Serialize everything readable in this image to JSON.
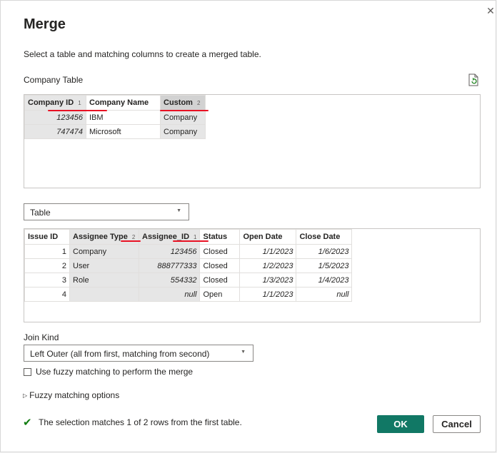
{
  "dialog": {
    "title": "Merge",
    "subtitle": "Select a table and matching columns to create a merged table.",
    "close_icon": "close-icon"
  },
  "first_table": {
    "label": "Company Table",
    "refresh_icon": "refresh-preview-icon",
    "columns": [
      {
        "name": "Company ID",
        "order": "1",
        "selected": true
      },
      {
        "name": "Company Name",
        "order": "",
        "selected": false
      },
      {
        "name": "Custom",
        "order": "2",
        "selected": true
      }
    ],
    "rows": [
      [
        "123456",
        "IBM",
        "Company"
      ],
      [
        "747474",
        "Microsoft",
        "Company"
      ]
    ]
  },
  "second_table": {
    "dropdown_value": "Table",
    "columns": [
      {
        "name": "Issue ID",
        "order": "",
        "selected": false
      },
      {
        "name": "Assignee Type",
        "order": "2",
        "selected": true
      },
      {
        "name": "Assignee_ID",
        "order": "1",
        "selected": true
      },
      {
        "name": "Status",
        "order": "",
        "selected": false
      },
      {
        "name": "Open Date",
        "order": "",
        "selected": false
      },
      {
        "name": "Close Date",
        "order": "",
        "selected": false
      }
    ],
    "rows": [
      [
        "1",
        "Company",
        "123456",
        "Closed",
        "1/1/2023",
        "1/6/2023"
      ],
      [
        "2",
        "User",
        "888777333",
        "Closed",
        "1/2/2023",
        "1/5/2023"
      ],
      [
        "3",
        "Role",
        "554332",
        "Closed",
        "1/3/2023",
        "1/4/2023"
      ],
      [
        "4",
        "",
        "null",
        "Open",
        "1/1/2023",
        "null"
      ]
    ]
  },
  "join": {
    "label": "Join Kind",
    "value": "Left Outer (all from first, matching from second)"
  },
  "fuzzy": {
    "checkbox_label": "Use fuzzy matching to perform the merge",
    "checked": false,
    "options_label": "Fuzzy matching options"
  },
  "status": {
    "icon": "checkmark-icon",
    "text": "The selection matches 1 of 2 rows from the first table."
  },
  "buttons": {
    "ok": "OK",
    "cancel": "Cancel"
  },
  "colors": {
    "ok_button": "#117865",
    "underline": "#e81123",
    "check": "#107c10",
    "selected_column": "#e6e6e6"
  }
}
